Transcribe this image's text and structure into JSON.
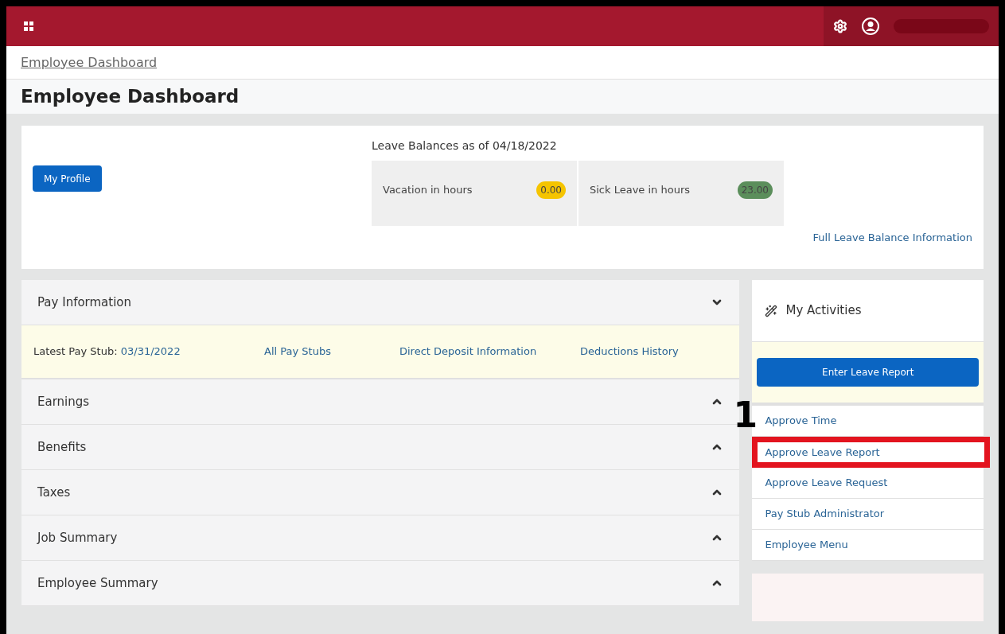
{
  "breadcrumb": "Employee Dashboard",
  "title": "Employee Dashboard",
  "profile_button": "My Profile",
  "leave_balances": {
    "heading": "Leave Balances as of 04/18/2022",
    "items": [
      {
        "label": "Vacation in hours",
        "value": "0.00",
        "color": "#f5c400"
      },
      {
        "label": "Sick Leave in hours",
        "value": "23.00",
        "color": "#5b8e5b"
      }
    ],
    "link": "Full Leave Balance Information"
  },
  "sections": [
    {
      "title": "Pay Information",
      "expanded": true,
      "content": {
        "label": "Latest Pay Stub:",
        "date": "03/31/2022",
        "links": [
          "All Pay Stubs",
          "Direct Deposit Information",
          "Deductions History"
        ]
      }
    },
    {
      "title": "Earnings",
      "expanded": false
    },
    {
      "title": "Benefits",
      "expanded": false
    },
    {
      "title": "Taxes",
      "expanded": false
    },
    {
      "title": "Job Summary",
      "expanded": false
    },
    {
      "title": "Employee Summary",
      "expanded": false
    }
  ],
  "activities": {
    "title": "My Activities",
    "button": "Enter Leave Report",
    "annotation": "1",
    "items": [
      {
        "label": "Approve Time",
        "highlighted": false
      },
      {
        "label": "Approve Leave Report",
        "highlighted": true
      },
      {
        "label": "Approve Leave Request",
        "highlighted": false
      },
      {
        "label": "Pay Stub Administrator",
        "highlighted": false
      },
      {
        "label": "Employee Menu",
        "highlighted": false
      }
    ]
  }
}
